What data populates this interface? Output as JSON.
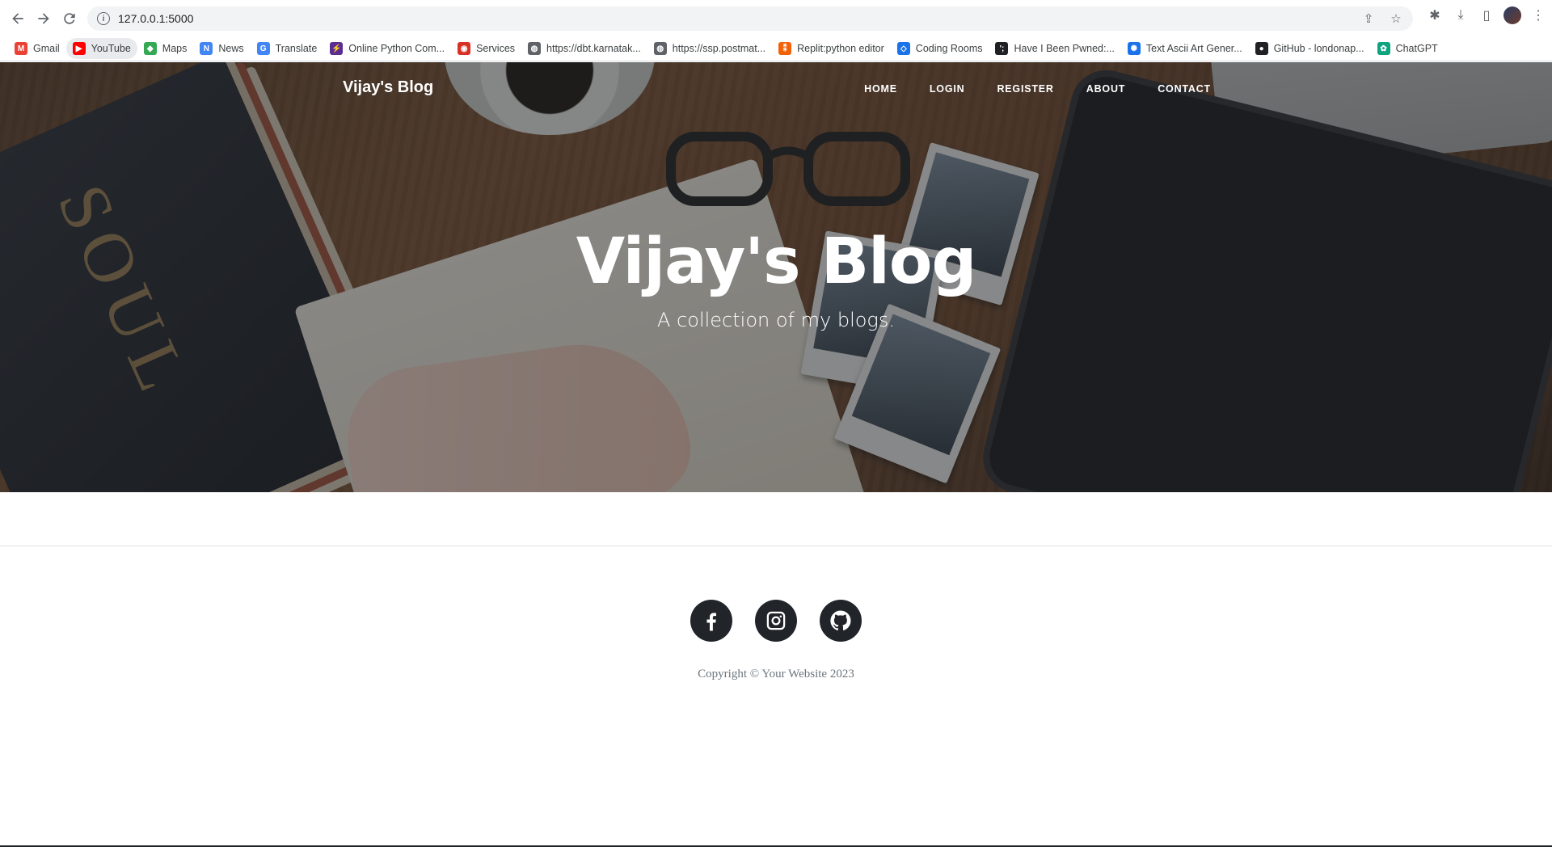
{
  "browser": {
    "url": "127.0.0.1:5000",
    "bookmarks": [
      {
        "label": "Gmail",
        "icon": "gmail-icon",
        "color": "#ea4335"
      },
      {
        "label": "YouTube",
        "icon": "youtube-icon",
        "color": "#ff0000"
      },
      {
        "label": "Maps",
        "icon": "maps-icon",
        "color": "#34a853"
      },
      {
        "label": "News",
        "icon": "news-icon",
        "color": "#4285f4"
      },
      {
        "label": "Translate",
        "icon": "translate-icon",
        "color": "#4285f4"
      },
      {
        "label": "Online Python Com...",
        "icon": "python-compiler-icon",
        "color": "#5c2d91"
      },
      {
        "label": "Services",
        "icon": "services-icon",
        "color": "#d93025"
      },
      {
        "label": "https://dbt.karnatak...",
        "icon": "globe-icon",
        "color": "#5f6368"
      },
      {
        "label": "https://ssp.postmat...",
        "icon": "globe-icon",
        "color": "#5f6368"
      },
      {
        "label": "Replit:python editor",
        "icon": "replit-icon",
        "color": "#f26207"
      },
      {
        "label": "Coding Rooms",
        "icon": "coding-rooms-icon",
        "color": "#1a73e8"
      },
      {
        "label": "Have I Been Pwned:...",
        "icon": "hibp-icon",
        "color": "#202124"
      },
      {
        "label": "Text Ascii Art Gener...",
        "icon": "ascii-art-icon",
        "color": "#1a73e8"
      },
      {
        "label": "GitHub - londonap...",
        "icon": "github-icon",
        "color": "#202124"
      },
      {
        "label": "ChatGPT",
        "icon": "chatgpt-icon",
        "color": "#10a37f"
      }
    ]
  },
  "site": {
    "brand": "Vijay's Blog",
    "nav": [
      "HOME",
      "LOGIN",
      "REGISTER",
      "ABOUT",
      "CONTACT"
    ],
    "hero": {
      "title": "Vijay's Blog",
      "subtitle": "A collection of my blogs."
    },
    "footer": {
      "socials": [
        "facebook-icon",
        "instagram-icon",
        "github-icon"
      ],
      "copyright": "Copyright © Your Website 2023"
    }
  }
}
